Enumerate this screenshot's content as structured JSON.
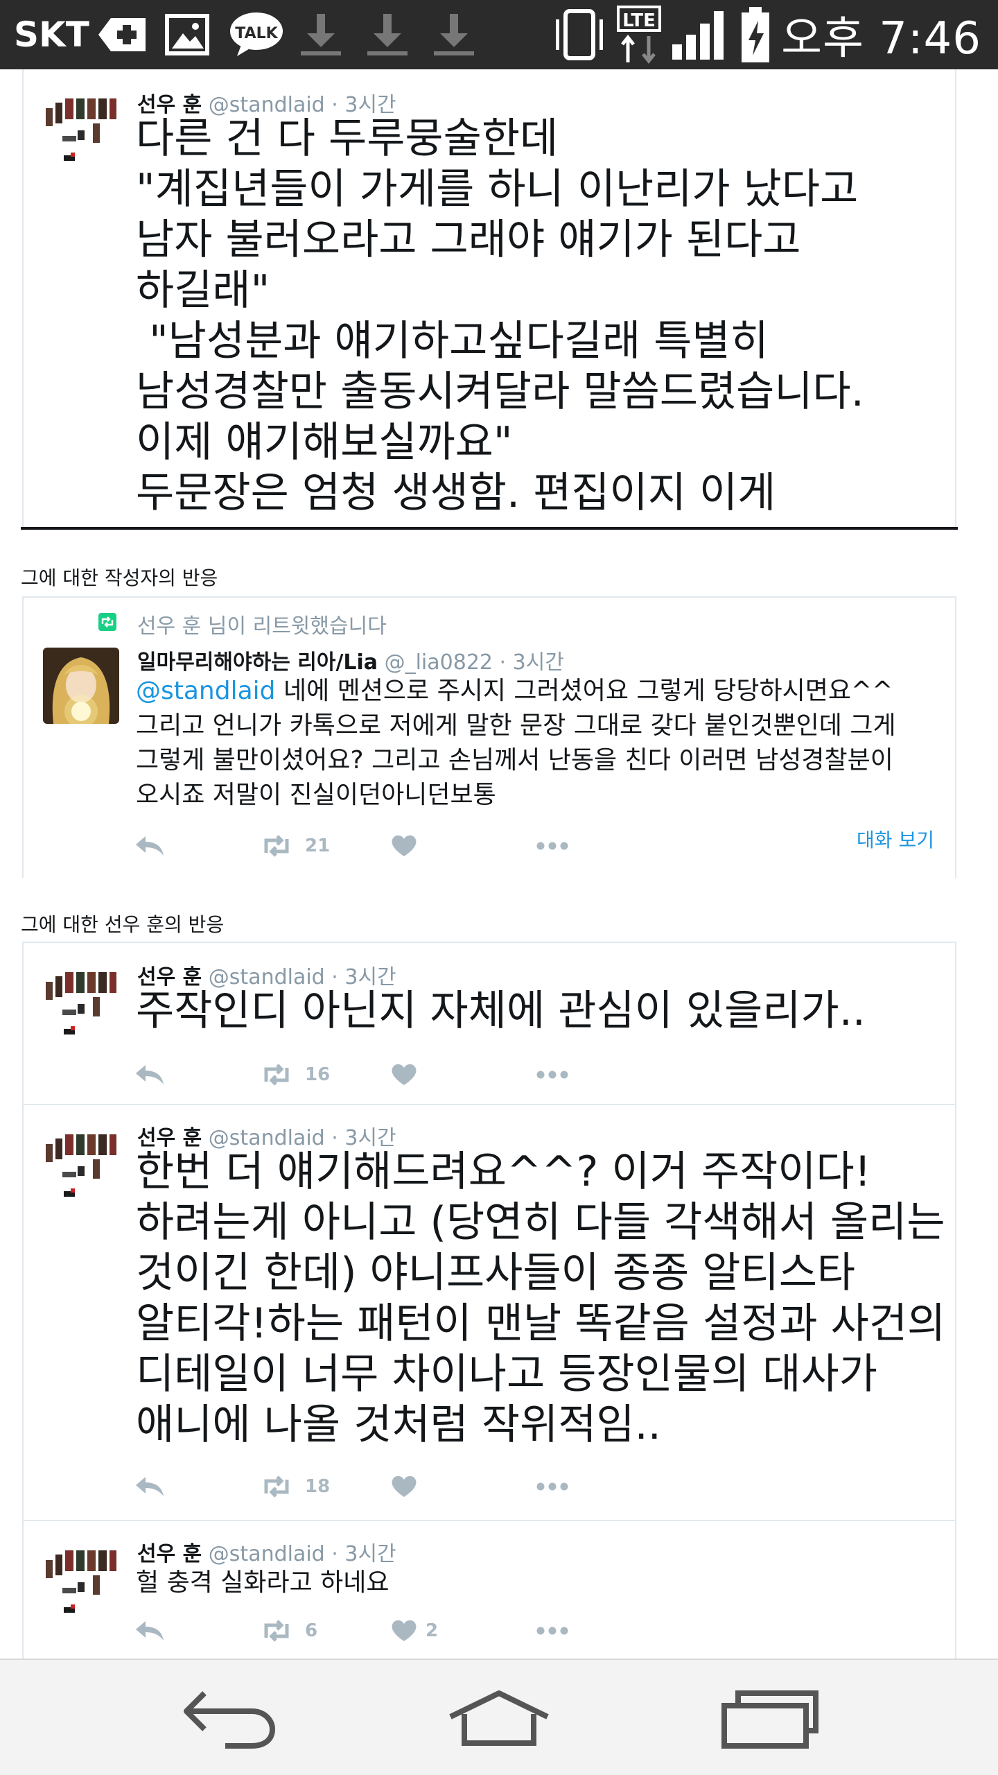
{
  "status_bar": {
    "carrier": "SKT",
    "time": "오후 7:46",
    "icons": [
      "plus-icon",
      "image-icon",
      "talk-icon",
      "download-icon",
      "download-icon",
      "download-icon",
      "vibrate-icon",
      "lte-icon",
      "signal-icon",
      "battery-charging-icon"
    ],
    "talk_label": "TALK",
    "lte_label": "LTE"
  },
  "tweets": [
    {
      "name": "선우 훈",
      "handle": "@standlaid",
      "time": "· 3시간",
      "text": "다른 건 다 두루뭉술한데\n\"계집년들이 가게를 하니 이난리가 났다고 남자 불러오라고 그래야 얘기가 된다고 하길래\"\n \"남성분과 얘기하고싶다길래 특별히 남성경찰만 출동시켜달라 말씀드렸습니다. 이제 얘기해보실까요\"\n두문장은 엄청 생생함. 편집이지 이게"
    },
    {
      "retweet_notice": "선우 훈 님이 리트윗했습니다",
      "name": "일마무리해야하는 리아/Lia",
      "handle": "@_lia0822",
      "time": "· 3시간",
      "mention": "@standlaid",
      "text": " 네에 멘션으로 주시지 그러셨어요 그렇게 당당하시면요^^ 그리고 언니가 카톡으로 저에게 말한 문장 그대로 갖다 붙인것뿐인데 그게 그렇게 불만이셨어요? 그리고 손님께서 난동을 친다 이러면 남성경찰분이 오시죠 저말이 진실이던아니던보통",
      "retweets": "21",
      "likes": "",
      "conversation_link": "대화 보기"
    },
    {
      "name": "선우 훈",
      "handle": "@standlaid",
      "time": "· 3시간",
      "text": "주작인디 아닌지 자체에 관심이 있을리가..",
      "retweets": "16",
      "likes": ""
    },
    {
      "name": "선우 훈",
      "handle": "@standlaid",
      "time": "· 3시간",
      "text": "한번 더 얘기해드려요^^? 이거 주작이다!하려는게 아니고 (당연히 다들 각색해서 올리는 것이긴 한데) 야니프사들이 종종 알티스타 알티각!하는 패턴이 맨날 똑같음 설정과 사건의 디테일이 너무 차이나고 등장인물의 대사가 애니에 나올 것처럼 작위적임..",
      "retweets": "18",
      "likes": ""
    },
    {
      "name": "선우 훈",
      "handle": "@standlaid",
      "time": "· 3시간",
      "text": "헐 충격 실화라고 하네요",
      "retweets": "6",
      "likes": "2"
    }
  ],
  "section_labels": {
    "author_reaction": "그에 대한 작성자의 반응",
    "sunwoo_reaction": "그에 대한 선우 훈의 반응"
  },
  "nav_bar": {
    "buttons": [
      "back-icon",
      "home-icon",
      "recent-apps-icon"
    ]
  },
  "colors": {
    "status_bar_bg": "#2b2b2b",
    "link_blue": "#1b95e0",
    "meta_gray": "#8899a6",
    "action_gray": "#aab8c2",
    "retweet_green": "#19cf86"
  }
}
